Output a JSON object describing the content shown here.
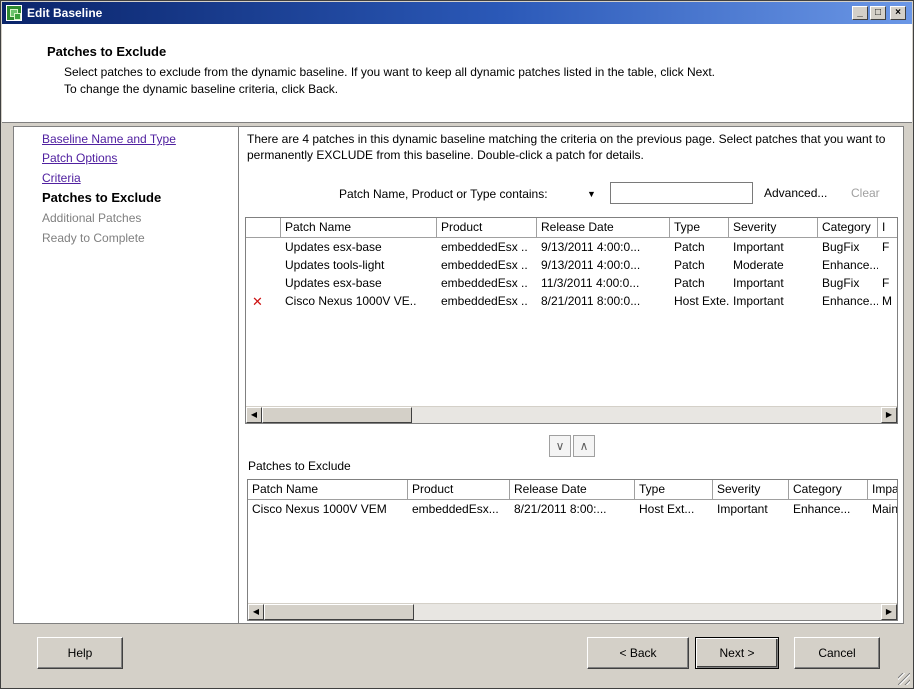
{
  "window": {
    "title": "Edit Baseline",
    "controls": {
      "minimize": "_",
      "maximize": "□",
      "close": "×"
    }
  },
  "header": {
    "title": "Patches to Exclude",
    "line1": "Select patches to exclude from the dynamic baseline. If you want to keep all dynamic patches listed in the table, click Next.",
    "line2": "To change the dynamic baseline criteria, click Back."
  },
  "nav": {
    "items": [
      {
        "label": "Baseline Name and Type",
        "state": "link"
      },
      {
        "label": "Patch Options",
        "state": "link"
      },
      {
        "label": "Criteria",
        "state": "link"
      },
      {
        "label": "Patches to Exclude",
        "state": "current"
      },
      {
        "label": "Additional Patches",
        "state": "disabled"
      },
      {
        "label": "Ready to Complete",
        "state": "disabled"
      }
    ]
  },
  "main": {
    "intro": "There are 4 patches in this dynamic baseline matching the criteria on the previous page. Select patches that you want to permanently EXCLUDE from this baseline. Double-click a patch for details.",
    "filter": {
      "label": "Patch Name, Product or Type contains:",
      "dropdown_glyph": "▼",
      "value": "",
      "advanced": "Advanced...",
      "clear": "Clear"
    },
    "patches_table": {
      "columns": [
        "",
        "Patch Name",
        "Product",
        "Release Date",
        "Type",
        "Severity",
        "Category",
        "I"
      ],
      "rows": [
        {
          "mark": "",
          "cells": [
            "Updates esx-base",
            "embeddedEsx ..",
            "9/13/2011 4:00:0...",
            "Patch",
            "Important",
            "BugFix",
            "F"
          ]
        },
        {
          "mark": "",
          "cells": [
            "Updates tools-light",
            "embeddedEsx ..",
            "9/13/2011 4:00:0...",
            "Patch",
            "Moderate",
            "Enhance...",
            ""
          ]
        },
        {
          "mark": "",
          "cells": [
            "Updates esx-base",
            "embeddedEsx ..",
            "11/3/2011 4:00:0...",
            "Patch",
            "Important",
            "BugFix",
            "F"
          ]
        },
        {
          "mark": "✕",
          "cells": [
            "Cisco Nexus 1000V VE..",
            "embeddedEsx ..",
            "8/21/2011 8:00:0...",
            "Host Exte..",
            "Important",
            "Enhance...",
            "M"
          ]
        }
      ]
    },
    "move_buttons": {
      "down": "∨",
      "up": "∧"
    },
    "exclude_label": "Patches to Exclude",
    "exclude_table": {
      "columns": [
        "Patch Name",
        "Product",
        "Release Date",
        "Type",
        "Severity",
        "Category",
        "Impac"
      ],
      "rows": [
        {
          "cells": [
            "Cisco Nexus 1000V VEM",
            "embeddedEsx...",
            "8/21/2011 8:00:...",
            "Host Ext...",
            "Important",
            "Enhance...",
            "Maint"
          ]
        }
      ]
    },
    "scroll_glyphs": {
      "left": "◀",
      "right": "▶"
    }
  },
  "buttons": {
    "help": "Help",
    "back": "< Back",
    "next": "Next >",
    "cancel": "Cancel"
  }
}
